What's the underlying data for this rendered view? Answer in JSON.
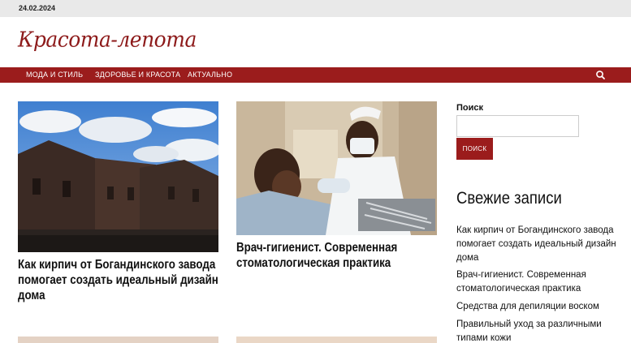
{
  "header": {
    "date": "24.02.2024",
    "site_name": "Красота-лепота"
  },
  "nav": {
    "items": [
      "МОДА И СТИЛЬ",
      "ЗДОРОВЬЕ И КРАСОТА",
      "АКТУАЛЬНО"
    ],
    "search_icon": "search-icon"
  },
  "posts": [
    {
      "title_lines": [
        "Как кирпич от Богандинского завода",
        "помогает создать идеальный дизайн",
        "дома"
      ]
    },
    {
      "title_lines": [
        "Врач-гигиенист. Современная",
        "стоматологическая практика"
      ]
    }
  ],
  "sidebar": {
    "search_label": "Поиск",
    "search_value": "",
    "search_button": "ПОИСК",
    "recent_title": "Свежие записи",
    "recent": [
      {
        "lines": [
          "Как кирпич от Богандинского завода",
          "помогает создать идеальный дизайн",
          "дома"
        ]
      },
      {
        "lines": [
          "Врач-гигиенист. Современная",
          "стоматологическая практика"
        ]
      },
      {
        "lines": [
          "Средства для депиляции воском"
        ]
      },
      {
        "lines": [
          "Правильный уход за различными",
          "типами кожи"
        ]
      }
    ]
  },
  "colors": {
    "accent": "#9b1c1c",
    "topbar": "#e9e9e9"
  }
}
